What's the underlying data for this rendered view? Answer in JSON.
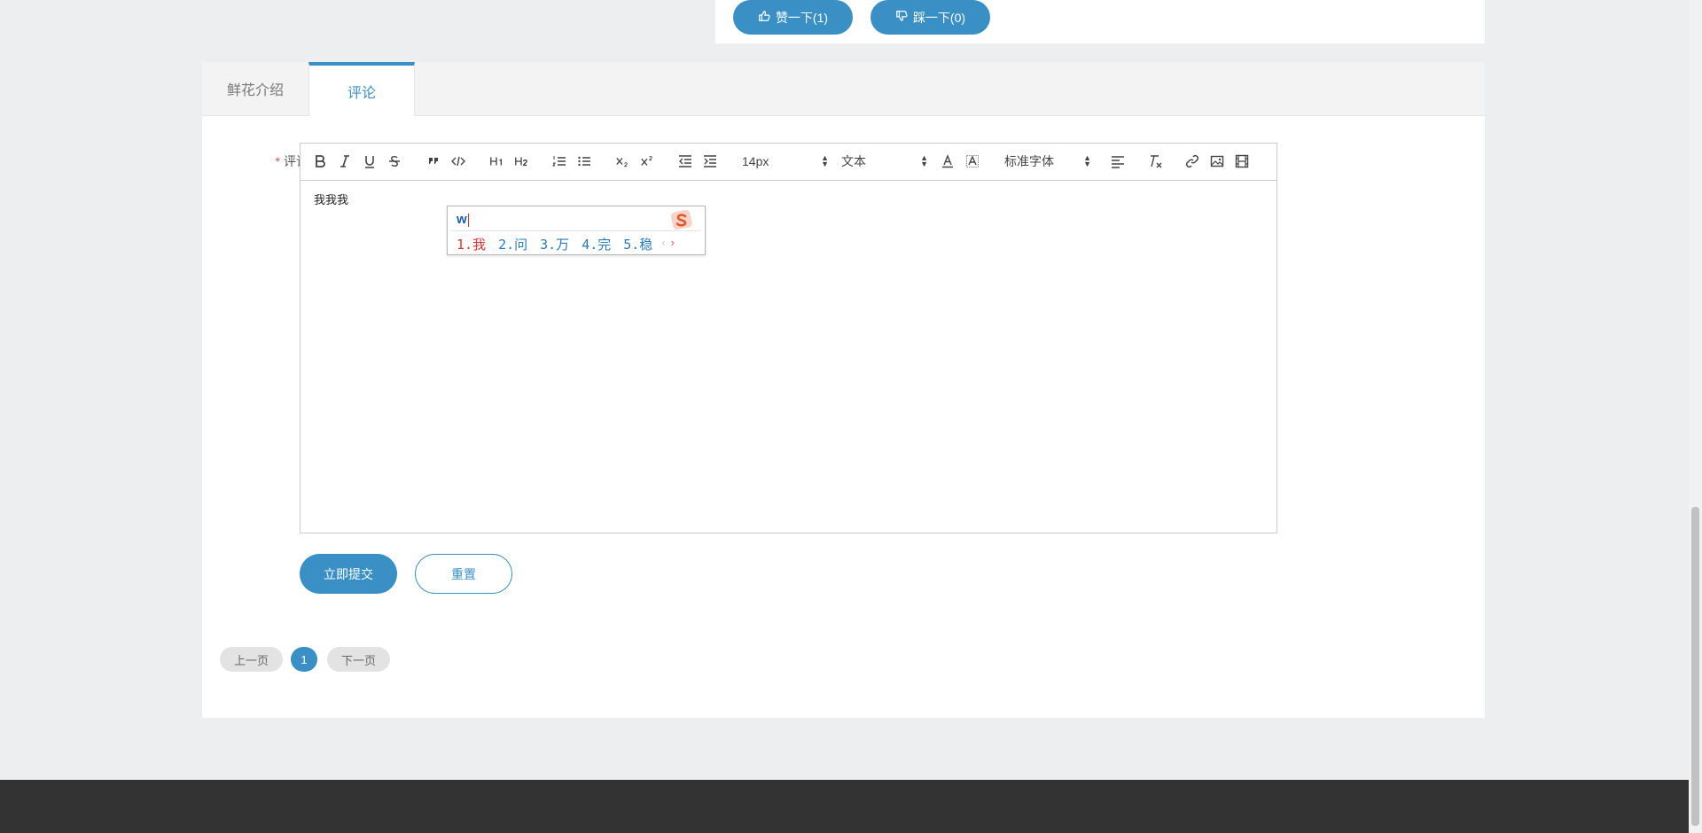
{
  "vote": {
    "like_label": "赞一下(1)",
    "dislike_label": "踩一下(0)"
  },
  "tabs": {
    "intro": "鲜花介绍",
    "comment": "评论"
  },
  "form": {
    "required_mark": "*",
    "label": "评论",
    "editor_text": "我我我",
    "font_size": "14px",
    "block_type": "文本",
    "font_family": "标准字体",
    "submit_label": "立即提交",
    "reset_label": "重置"
  },
  "ime": {
    "input": "w",
    "candidates": [
      "1.我",
      "2.问",
      "3.万",
      "4.完",
      "5.稳"
    ],
    "prev": "‹",
    "next": "›"
  },
  "pager": {
    "prev": "上一页",
    "current": "1",
    "next": "下一页"
  },
  "colors": {
    "accent": "#3a8fc4",
    "footer": "#333333",
    "page_bg": "#eceef0"
  }
}
